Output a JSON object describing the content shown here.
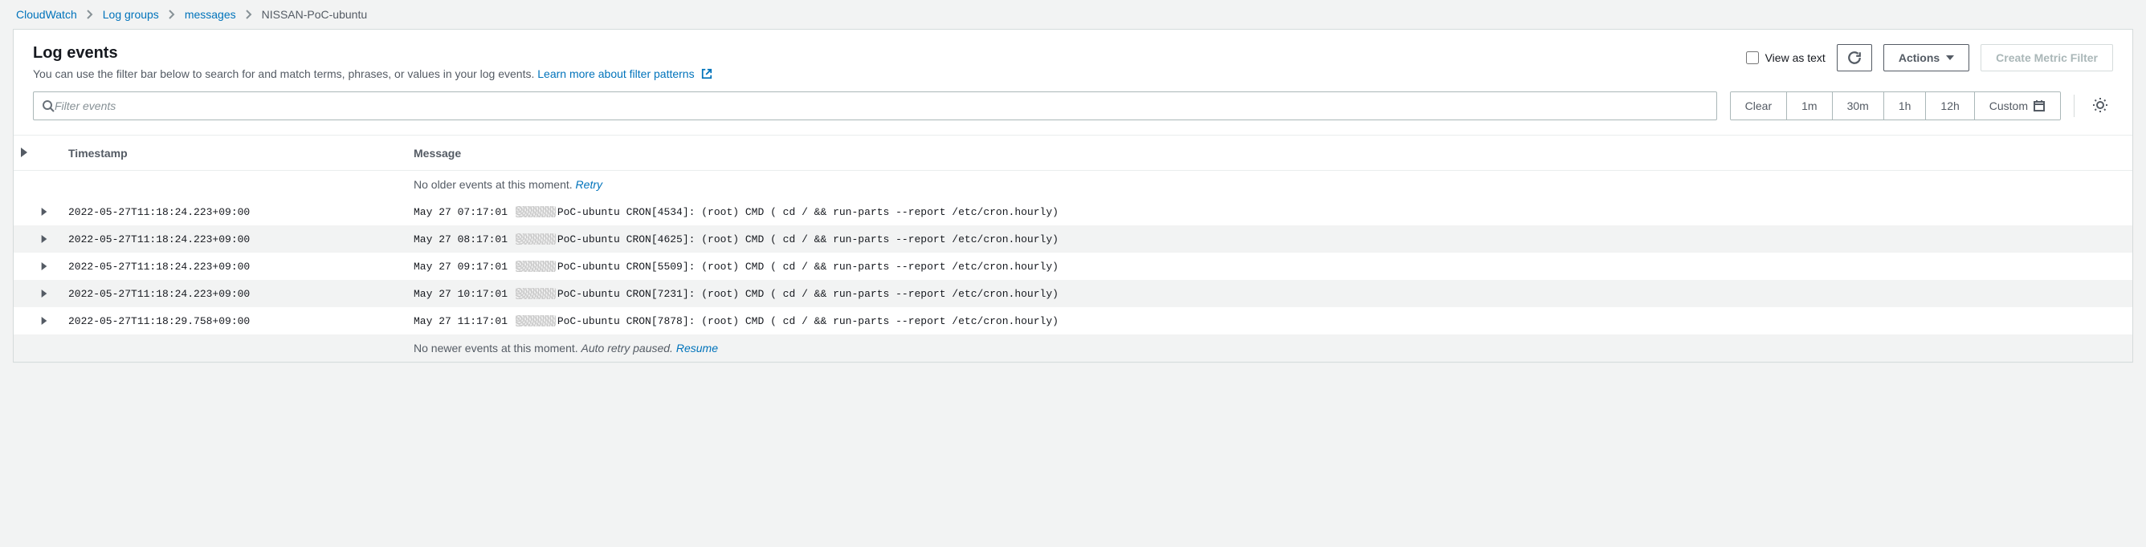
{
  "breadcrumb": {
    "items": [
      "CloudWatch",
      "Log groups",
      "messages"
    ],
    "current": "NISSAN-PoC-ubuntu"
  },
  "header": {
    "title": "Log events",
    "subtitle_pre": "You can use the filter bar below to search for and match terms, phrases, or values in your log events. ",
    "learn_label": "Learn more about filter patterns",
    "view_as_text": "View as text",
    "actions_label": "Actions",
    "create_metric": "Create Metric Filter"
  },
  "filter": {
    "placeholder": "Filter events",
    "time": [
      "Clear",
      "1m",
      "30m",
      "1h",
      "12h"
    ],
    "custom_label": "Custom"
  },
  "table": {
    "head": [
      "",
      "Timestamp",
      "Message"
    ],
    "no_older_pre": "No older events at this moment. ",
    "no_older_link": "Retry",
    "no_newer_pre": "No newer events at this moment. ",
    "no_newer_mid": "Auto retry paused. ",
    "no_newer_link": "Resume",
    "rows": [
      {
        "ts": "2022-05-27T11:18:24.223+09:00",
        "m_pre": "May 27 07:17:01 ",
        "m_post": "PoC-ubuntu CRON[4534]: (root) CMD ( cd / && run-parts --report /etc/cron.hourly)"
      },
      {
        "ts": "2022-05-27T11:18:24.223+09:00",
        "m_pre": "May 27 08:17:01 ",
        "m_post": "PoC-ubuntu CRON[4625]: (root) CMD ( cd / && run-parts --report /etc/cron.hourly)"
      },
      {
        "ts": "2022-05-27T11:18:24.223+09:00",
        "m_pre": "May 27 09:17:01 ",
        "m_post": "PoC-ubuntu CRON[5509]: (root) CMD ( cd / && run-parts --report /etc/cron.hourly)"
      },
      {
        "ts": "2022-05-27T11:18:24.223+09:00",
        "m_pre": "May 27 10:17:01 ",
        "m_post": "PoC-ubuntu CRON[7231]: (root) CMD ( cd / && run-parts --report /etc/cron.hourly)"
      },
      {
        "ts": "2022-05-27T11:18:29.758+09:00",
        "m_pre": "May 27 11:17:01 ",
        "m_post": "PoC-ubuntu CRON[7878]: (root) CMD ( cd / && run-parts --report /etc/cron.hourly)"
      }
    ]
  }
}
